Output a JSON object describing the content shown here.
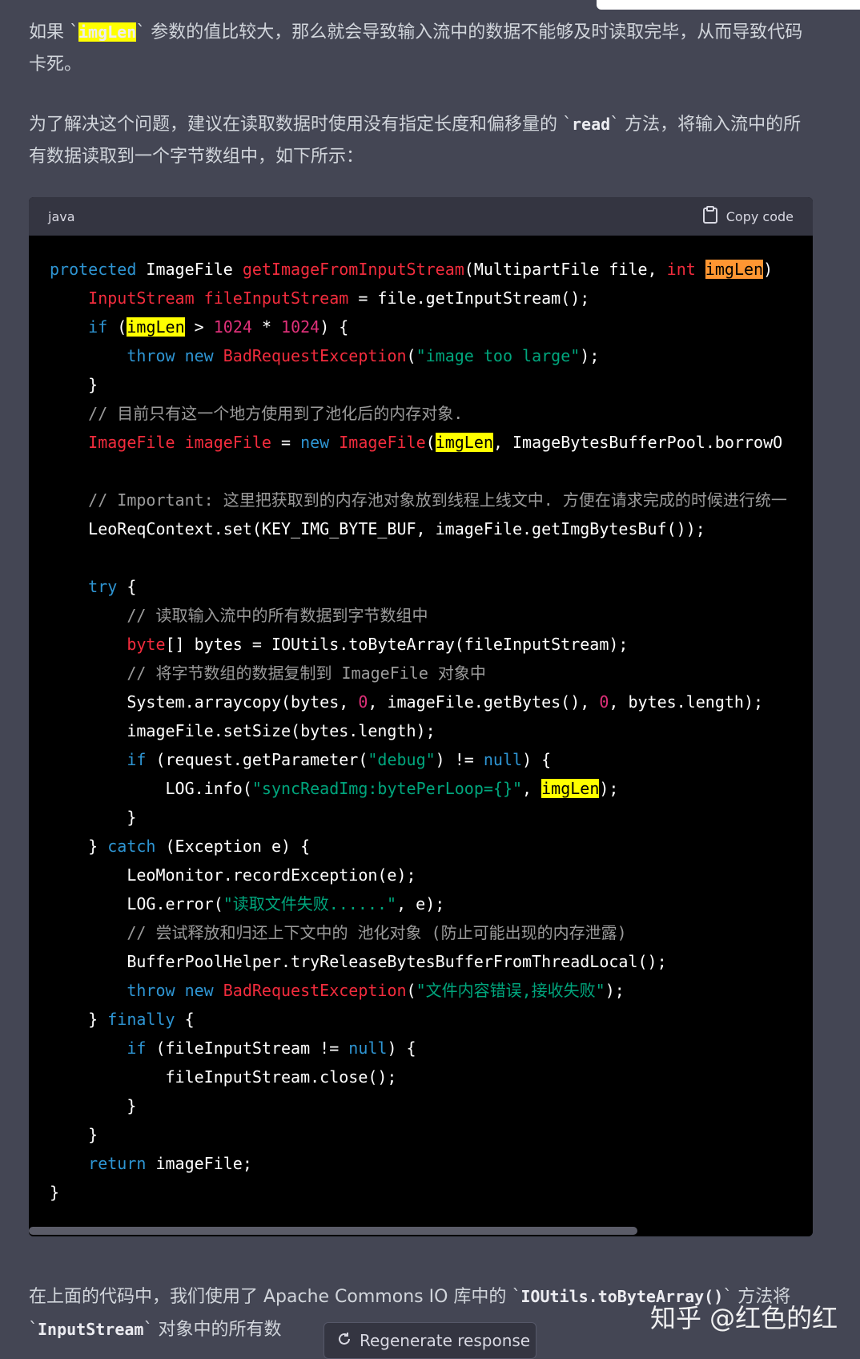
{
  "paragraphs": {
    "p1": [
      "如果 `",
      "imgLen",
      "` 参数的值比较大，那么就会导致输入流中的数据不能够及时读取完毕，从而导致代码卡死。"
    ],
    "p2a": "为了解决这个问题，建议在读取数据时使用没有指定长度和偏移量的 `",
    "p2code": "read",
    "p2b": "` 方法，将输入流中的所有数据读取到一个字节数组中，如下所示：",
    "p3a": "在上面的代码中，我们使用了 Apache Commons IO 库中的 `",
    "p3code": "IOUtils.toByteArray()",
    "p3b": "` 方法将 `",
    "p3code2": "InputStream",
    "p3c": "` 对象中的所有数"
  },
  "code_block": {
    "language": "java",
    "copy_label": "Copy code"
  },
  "code_lines": [
    [
      [
        "kw",
        "protected"
      ],
      [
        "p",
        " ImageFile "
      ],
      [
        "ty",
        "getImageFromInputStream"
      ],
      [
        "p",
        "(MultipartFile file, "
      ],
      [
        "ty",
        "int"
      ],
      [
        "p",
        " "
      ],
      [
        "ho",
        "imgLen"
      ],
      [
        "p",
        ")"
      ]
    ],
    [
      [
        "p",
        "    "
      ],
      [
        "ty",
        "InputStream"
      ],
      [
        "p",
        " "
      ],
      [
        "ty",
        "fileInputStream"
      ],
      [
        "p",
        " = file.getInputStream();"
      ]
    ],
    [
      [
        "p",
        "    "
      ],
      [
        "kw",
        "if"
      ],
      [
        "p",
        " ("
      ],
      [
        "hl",
        "imgLen"
      ],
      [
        "p",
        " > "
      ],
      [
        "nu",
        "1024"
      ],
      [
        "p",
        " * "
      ],
      [
        "nu",
        "1024"
      ],
      [
        "p",
        ") {"
      ]
    ],
    [
      [
        "p",
        "        "
      ],
      [
        "kw",
        "throw"
      ],
      [
        "p",
        " "
      ],
      [
        "kw",
        "new"
      ],
      [
        "p",
        " "
      ],
      [
        "ty",
        "BadRequestException"
      ],
      [
        "p",
        "("
      ],
      [
        "st",
        "\"image too large\""
      ],
      [
        "p",
        ");"
      ]
    ],
    [
      [
        "p",
        "    }"
      ]
    ],
    [
      [
        "p",
        "    "
      ],
      [
        "cm",
        "// 目前只有这一个地方使用到了池化后的内存对象."
      ]
    ],
    [
      [
        "p",
        "    "
      ],
      [
        "ty",
        "ImageFile"
      ],
      [
        "p",
        " "
      ],
      [
        "ty",
        "imageFile"
      ],
      [
        "p",
        " = "
      ],
      [
        "kw",
        "new"
      ],
      [
        "p",
        " "
      ],
      [
        "ty",
        "ImageFile"
      ],
      [
        "p",
        "("
      ],
      [
        "hl",
        "imgLen"
      ],
      [
        "p",
        ", ImageBytesBufferPool.borrowO"
      ]
    ],
    [
      [
        "p",
        ""
      ]
    ],
    [
      [
        "p",
        "    "
      ],
      [
        "cm",
        "// Important: 这里把获取到的内存池对象放到线程上线文中. 方便在请求完成的时候进行统一"
      ]
    ],
    [
      [
        "p",
        "    LeoReqContext.set(KEY_IMG_BYTE_BUF, imageFile.getImgBytesBuf());"
      ]
    ],
    [
      [
        "p",
        ""
      ]
    ],
    [
      [
        "p",
        "    "
      ],
      [
        "kw",
        "try"
      ],
      [
        "p",
        " {"
      ]
    ],
    [
      [
        "p",
        "        "
      ],
      [
        "cm",
        "// 读取输入流中的所有数据到字节数组中"
      ]
    ],
    [
      [
        "p",
        "        "
      ],
      [
        "ty",
        "byte"
      ],
      [
        "p",
        "[] bytes = IOUtils.toByteArray(fileInputStream);"
      ]
    ],
    [
      [
        "p",
        "        "
      ],
      [
        "cm",
        "// 将字节数组的数据复制到 ImageFile 对象中"
      ]
    ],
    [
      [
        "p",
        "        System.arraycopy(bytes, "
      ],
      [
        "nu",
        "0"
      ],
      [
        "p",
        ", imageFile.getBytes(), "
      ],
      [
        "nu",
        "0"
      ],
      [
        "p",
        ", bytes.length);"
      ]
    ],
    [
      [
        "p",
        "        imageFile.setSize(bytes.length);"
      ]
    ],
    [
      [
        "p",
        "        "
      ],
      [
        "kw",
        "if"
      ],
      [
        "p",
        " (request.getParameter("
      ],
      [
        "st",
        "\"debug\""
      ],
      [
        "p",
        ") != "
      ],
      [
        "kw",
        "null"
      ],
      [
        "p",
        ") {"
      ]
    ],
    [
      [
        "p",
        "            LOG.info("
      ],
      [
        "st",
        "\"syncReadImg:bytePerLoop={}\""
      ],
      [
        "p",
        ", "
      ],
      [
        "hl",
        "imgLen"
      ],
      [
        "p",
        ");"
      ]
    ],
    [
      [
        "p",
        "        }"
      ]
    ],
    [
      [
        "p",
        "    } "
      ],
      [
        "kw",
        "catch"
      ],
      [
        "p",
        " (Exception e) {"
      ]
    ],
    [
      [
        "p",
        "        LeoMonitor.recordException(e);"
      ]
    ],
    [
      [
        "p",
        "        LOG.error("
      ],
      [
        "st",
        "\"读取文件失败......\""
      ],
      [
        "p",
        ", e);"
      ]
    ],
    [
      [
        "p",
        "        "
      ],
      [
        "cm",
        "// 尝试释放和归还上下文中的 池化对象 (防止可能出现的内存泄露)"
      ]
    ],
    [
      [
        "p",
        "        BufferPoolHelper.tryReleaseBytesBufferFromThreadLocal();"
      ]
    ],
    [
      [
        "p",
        "        "
      ],
      [
        "kw",
        "throw"
      ],
      [
        "p",
        " "
      ],
      [
        "kw",
        "new"
      ],
      [
        "p",
        " "
      ],
      [
        "ty",
        "BadRequestException"
      ],
      [
        "p",
        "("
      ],
      [
        "st",
        "\"文件内容错误,接收失败\""
      ],
      [
        "p",
        ");"
      ]
    ],
    [
      [
        "p",
        "    } "
      ],
      [
        "kw",
        "finally"
      ],
      [
        "p",
        " {"
      ]
    ],
    [
      [
        "p",
        "        "
      ],
      [
        "kw",
        "if"
      ],
      [
        "p",
        " (fileInputStream != "
      ],
      [
        "kw",
        "null"
      ],
      [
        "p",
        ") {"
      ]
    ],
    [
      [
        "p",
        "            fileInputStream.close();"
      ]
    ],
    [
      [
        "p",
        "        }"
      ]
    ],
    [
      [
        "p",
        "    }"
      ]
    ],
    [
      [
        "p",
        "    "
      ],
      [
        "kw",
        "return"
      ],
      [
        "p",
        " imageFile;"
      ]
    ],
    [
      [
        "p",
        "}"
      ]
    ]
  ],
  "regenerate_label": "Regenerate response",
  "watermark": "知乎 @红色的红"
}
